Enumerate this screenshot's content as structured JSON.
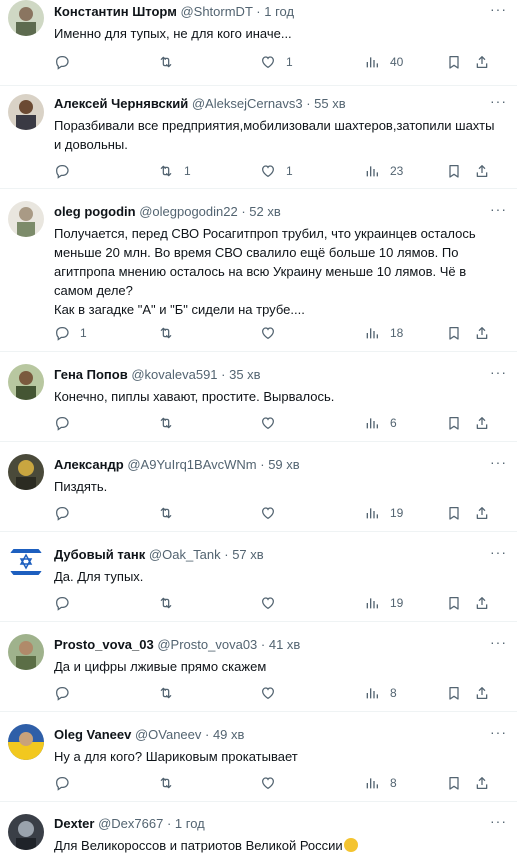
{
  "tweets": [
    {
      "name": "Константин Шторм",
      "handle": "@ShtormDT",
      "time": "· 1 год",
      "text": "Именно для тупых, не для кого иначе...",
      "replies": "",
      "retweets": "",
      "likes": "1",
      "views": "40"
    },
    {
      "name": "Алексей Чернявский",
      "handle": "@AleksejCernavs3",
      "time": "· 55 хв",
      "text": "Поразбивали все предприятия,мобилизовали шахтеров,затопили шахты и довольны.",
      "replies": "",
      "retweets": "1",
      "likes": "1",
      "views": "23"
    },
    {
      "name": "oleg pogodin",
      "handle": "@olegpogodin22",
      "time": "· 52 хв",
      "text": "Получается, перед СВО Росагитпроп трубил, что украинцев осталось меньше 20 млн. Во время СВО свалило ещё  больше 10 лямов. По агитпропа мнению осталось на всю Украину меньше 10 лямов. Чё в самом деле?\nКак в загадке \"А\" и \"Б\" сидели на трубе....",
      "replies": "1",
      "retweets": "",
      "likes": "",
      "views": "18"
    },
    {
      "name": "Гена Попов",
      "handle": "@kovaleva591",
      "time": "· 35 хв",
      "text": "Конечно, пиплы хавают, простите. Вырвалось.",
      "replies": "",
      "retweets": "",
      "likes": "",
      "views": "6"
    },
    {
      "name": "Александр",
      "handle": "@A9YuIrq1BAvcWNm",
      "time": "· 59 хв",
      "text": "Пиздять.",
      "replies": "",
      "retweets": "",
      "likes": "",
      "views": "19"
    },
    {
      "name": "Дубовый танк",
      "handle": "@Oak_Tank",
      "time": "· 57 хв",
      "text": "Да. Для тупых.",
      "replies": "",
      "retweets": "",
      "likes": "",
      "views": "19"
    },
    {
      "name": "Prosto_vova_03",
      "handle": "@Prosto_vova03",
      "time": "· 41 хв",
      "text": "Да и цифры лживые прямо скажем",
      "replies": "",
      "retweets": "",
      "likes": "",
      "views": "8"
    },
    {
      "name": "Oleg Vaneev",
      "handle": "@OVaneev",
      "time": "· 49 хв",
      "text": "Ну а для кого? Шариковым прокатывает",
      "replies": "",
      "retweets": "",
      "likes": "",
      "views": "8"
    },
    {
      "name": "Dexter",
      "handle": "@Dex7667",
      "time": "· 1 год",
      "text": "Для Великороссов и патриотов Великой России",
      "replies": "",
      "retweets": "",
      "likes": "",
      "views": ""
    }
  ],
  "icons": {
    "reply": "reply-icon",
    "retweet": "retweet-icon",
    "like": "heart-icon",
    "views": "views-icon",
    "bookmark": "bookmark-icon",
    "share": "share-icon",
    "more": "more-icon"
  }
}
